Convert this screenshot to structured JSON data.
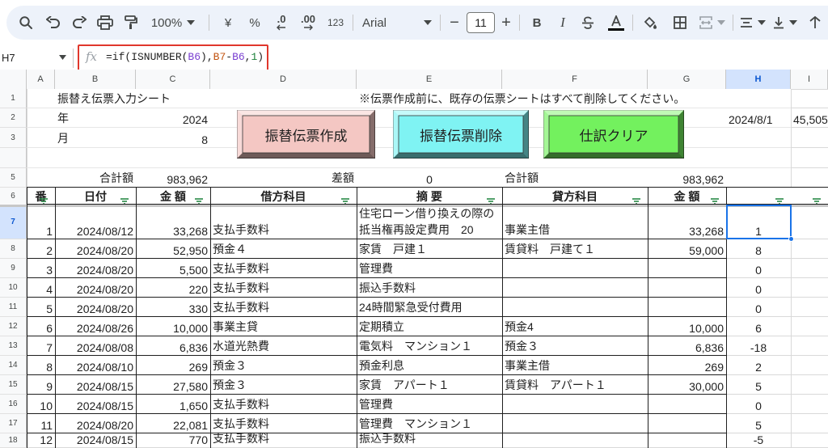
{
  "toolbar": {
    "zoom": "100%",
    "currency": "¥",
    "percent": "%",
    "decrease_decimals": ".0",
    "increase_decimals": ".00",
    "number_format": "123",
    "font_name": "Arial",
    "font_size": "11",
    "minus": "−",
    "plus": "+",
    "bold": "B",
    "italic": "I"
  },
  "formula_bar": {
    "cell_ref": "H7",
    "fx": "fx",
    "formula_parts": [
      "=if(ISNUMBER(",
      "B6",
      "),",
      "B7",
      "-",
      "B6",
      ",",
      "1",
      ")"
    ]
  },
  "columns": [
    "A",
    "B",
    "C",
    "D",
    "E",
    "F",
    "G",
    "H",
    "I"
  ],
  "selected_column": "H",
  "rows": [
    "1",
    "2",
    "3",
    "",
    "5",
    "6",
    "7",
    "8",
    "9",
    "10",
    "11",
    "12",
    "13",
    "14",
    "15",
    "16",
    "17",
    "18"
  ],
  "top_area": {
    "title": "振替え伝票入力シート",
    "notice": "※伝票作成前に、既存の伝票シートはすべて削除してください。",
    "year_label": "年",
    "year_value": "2024",
    "month_label": "月",
    "month_value": "8",
    "h2_value": "2024/8/1",
    "i2_value": "45,505",
    "total_label_left": "合計額",
    "total_left": "983,962",
    "diff_label": "差額",
    "diff_value": "0",
    "total_label_right": "合計額",
    "total_right": "983,962"
  },
  "buttons": {
    "create": "振替伝票作成",
    "delete": "振替伝票削除",
    "clear": "仕訳クリア"
  },
  "button_colors": {
    "create": "#f4c7c3",
    "delete": "#7ff3f3",
    "clear": "#73f15e"
  },
  "table_headers": {
    "no": "番",
    "date": "日付",
    "amount_left": "金 額",
    "debit": "借方科目",
    "memo": "摘 要",
    "credit": "貸方科目",
    "amount_right": "金 額"
  },
  "table_rows": [
    {
      "no": "1",
      "date": "2024/08/12",
      "amount": "33,268",
      "debit": "支払手数料",
      "memo": "住宅ローン借り換えの際の抵当権再設定費用　20",
      "credit": "事業主借",
      "amount2": "33,268",
      "h": "1"
    },
    {
      "no": "2",
      "date": "2024/08/20",
      "amount": "52,950",
      "debit": "預金４",
      "memo": "家賃　戸建１",
      "credit": "賃貸料　戸建て１",
      "amount2": "59,000",
      "h": "8"
    },
    {
      "no": "3",
      "date": "2024/08/20",
      "amount": "5,500",
      "debit": "支払手数料",
      "memo": "管理費",
      "credit": "",
      "amount2": "",
      "h": "0"
    },
    {
      "no": "4",
      "date": "2024/08/20",
      "amount": "220",
      "debit": "支払手数料",
      "memo": "振込手数料",
      "credit": "",
      "amount2": "",
      "h": "0"
    },
    {
      "no": "5",
      "date": "2024/08/20",
      "amount": "330",
      "debit": "支払手数料",
      "memo": "24時間緊急受付費用",
      "credit": "",
      "amount2": "",
      "h": "0"
    },
    {
      "no": "6",
      "date": "2024/08/26",
      "amount": "10,000",
      "debit": "事業主貸",
      "memo": "定期積立",
      "credit": "預金4",
      "amount2": "10,000",
      "h": "6"
    },
    {
      "no": "7",
      "date": "2024/08/08",
      "amount": "6,836",
      "debit": "水道光熱費",
      "memo": "電気料　マンション１",
      "credit": "預金３",
      "amount2": "6,836",
      "h": "-18"
    },
    {
      "no": "8",
      "date": "2024/08/10",
      "amount": "269",
      "debit": "預金３",
      "memo": "預金利息",
      "credit": "事業主借",
      "amount2": "269",
      "h": "2"
    },
    {
      "no": "9",
      "date": "2024/08/15",
      "amount": "27,580",
      "debit": "預金３",
      "memo": "家賃　アパート１",
      "credit": "賃貸料　アパート１",
      "amount2": "30,000",
      "h": "5"
    },
    {
      "no": "10",
      "date": "2024/08/15",
      "amount": "1,650",
      "debit": "支払手数料",
      "memo": "管理費",
      "credit": "",
      "amount2": "",
      "h": "0"
    },
    {
      "no": "11",
      "date": "2024/08/20",
      "amount": "22,081",
      "debit": "支払手数料",
      "memo": "管理費　マンション１",
      "credit": "",
      "amount2": "",
      "h": "5"
    },
    {
      "no": "12",
      "date": "2024/08/15",
      "amount": "770",
      "debit": "支払手数料",
      "memo": "振込手数料",
      "credit": "",
      "amount2": "",
      "h": "-5"
    }
  ]
}
